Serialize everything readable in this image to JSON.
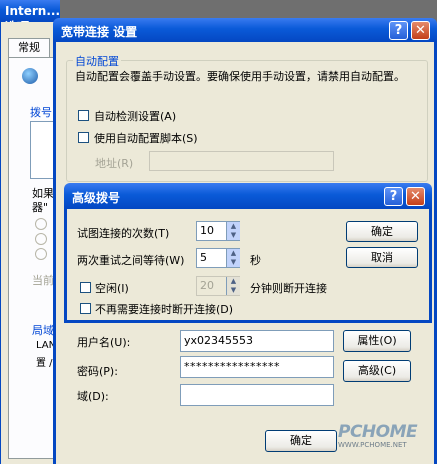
{
  "back_window": {
    "title": "Intern... 选项",
    "tab": "常规",
    "dialup_label": "拨号",
    "if_text": "如果",
    "if_text2": "器\"",
    "current_label": "当前",
    "lan_label": "局域",
    "lan_text1": "LAN",
    "lan_text2": "置 /"
  },
  "broadband_window": {
    "title": "宽带连接 设置",
    "auto_config": {
      "group_label": "自动配置",
      "description": "自动配置会覆盖手动设置。要确保使用手动设置，请禁用自动配置。",
      "auto_detect_label": "自动检测设置(A)",
      "auto_script_label": "使用自动配置脚本(S)",
      "address_label": "地址(R)"
    },
    "username_label": "用户名(U):",
    "username_value": "yx02345553",
    "password_label": "密码(P):",
    "password_value": "****************",
    "domain_label": "域(D):",
    "properties_button": "属性(O)",
    "advanced_button": "高级(C)",
    "ok_button": "确定"
  },
  "advanced_dialup": {
    "title": "高级拨号",
    "retry_label": "试图连接的次数(T)",
    "retry_value": "10",
    "wait_label": "两次重试之间等待(W)",
    "wait_value": "5",
    "wait_unit": "秒",
    "idle_label": "空闲(I)",
    "idle_value": "20",
    "idle_suffix": "分钟则断开连接",
    "no_disconnect_label": "不再需要连接时断开连接(D)",
    "ok_button": "确定",
    "cancel_button": "取消"
  },
  "watermark": {
    "brand": "PCHOME",
    "url": "WWW.PCHOME.NET"
  }
}
